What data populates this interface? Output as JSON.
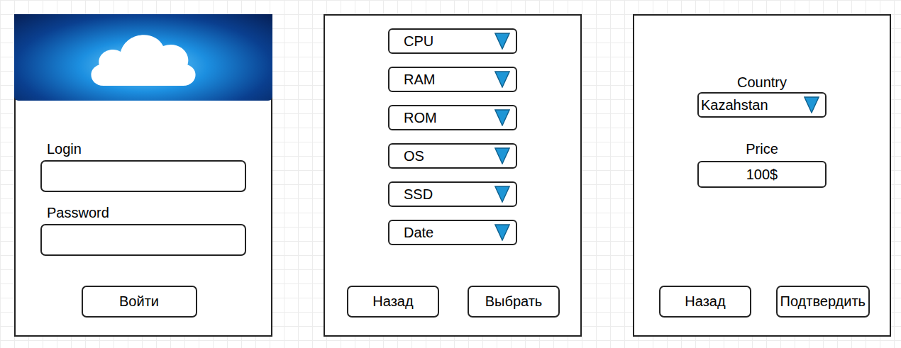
{
  "login": {
    "fields": [
      {
        "label": "Login",
        "value": ""
      },
      {
        "label": "Password",
        "value": ""
      }
    ],
    "button": "Войти"
  },
  "config": {
    "dropdowns": [
      "CPU",
      "RAM",
      "ROM",
      "OS",
      "SSD",
      "Date"
    ],
    "buttons": [
      "Назад",
      "Выбрать"
    ]
  },
  "order": {
    "country": {
      "label": "Country",
      "value": "Kazahstan"
    },
    "price": {
      "label": "Price",
      "value": "100$"
    },
    "buttons": [
      "Назад",
      "Подтвердить"
    ]
  }
}
